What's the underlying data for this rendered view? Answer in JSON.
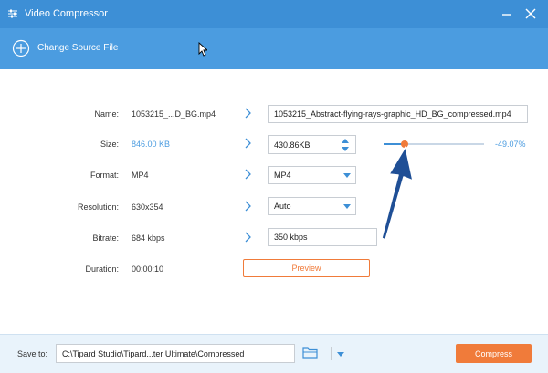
{
  "window": {
    "title": "Video Compressor"
  },
  "toolbar": {
    "add_label": "Change Source File"
  },
  "rows": {
    "name": {
      "label": "Name:",
      "original": "1053215_...D_BG.mp4",
      "target": "1053215_Abstract-flying-rays-graphic_HD_BG_compressed.mp4"
    },
    "size": {
      "label": "Size:",
      "original": "846.00 KB",
      "target": "430.86KB"
    },
    "format": {
      "label": "Format:",
      "original": "MP4",
      "target": "MP4"
    },
    "resolution": {
      "label": "Resolution:",
      "original": "630x354",
      "target": "Auto"
    },
    "bitrate": {
      "label": "Bitrate:",
      "original": "684 kbps",
      "target": "350 kbps"
    },
    "duration": {
      "label": "Duration:",
      "original": "00:00:10"
    }
  },
  "slider": {
    "percent_label": "-49.07%",
    "value_fraction": 0.21
  },
  "preview": {
    "label": "Preview"
  },
  "footer": {
    "save_label": "Save to:",
    "path": "C:\\Tipard Studio\\Tipard...ter Ultimate\\Compressed",
    "compress_label": "Compress"
  },
  "colors": {
    "titlebar": "#3d8fd6",
    "toolbar": "#4b9ce0",
    "accent": "#f07b3a",
    "link": "#4b9ce0"
  },
  "icons": {
    "app": "sliders-icon",
    "minimize": "minimize-icon",
    "close": "close-icon",
    "add": "plus-circle-icon",
    "chevron": "chevron-right-icon",
    "folder": "folder-icon",
    "annotation": "arrow-up-icon",
    "cursor": "mouse-cursor-icon"
  }
}
